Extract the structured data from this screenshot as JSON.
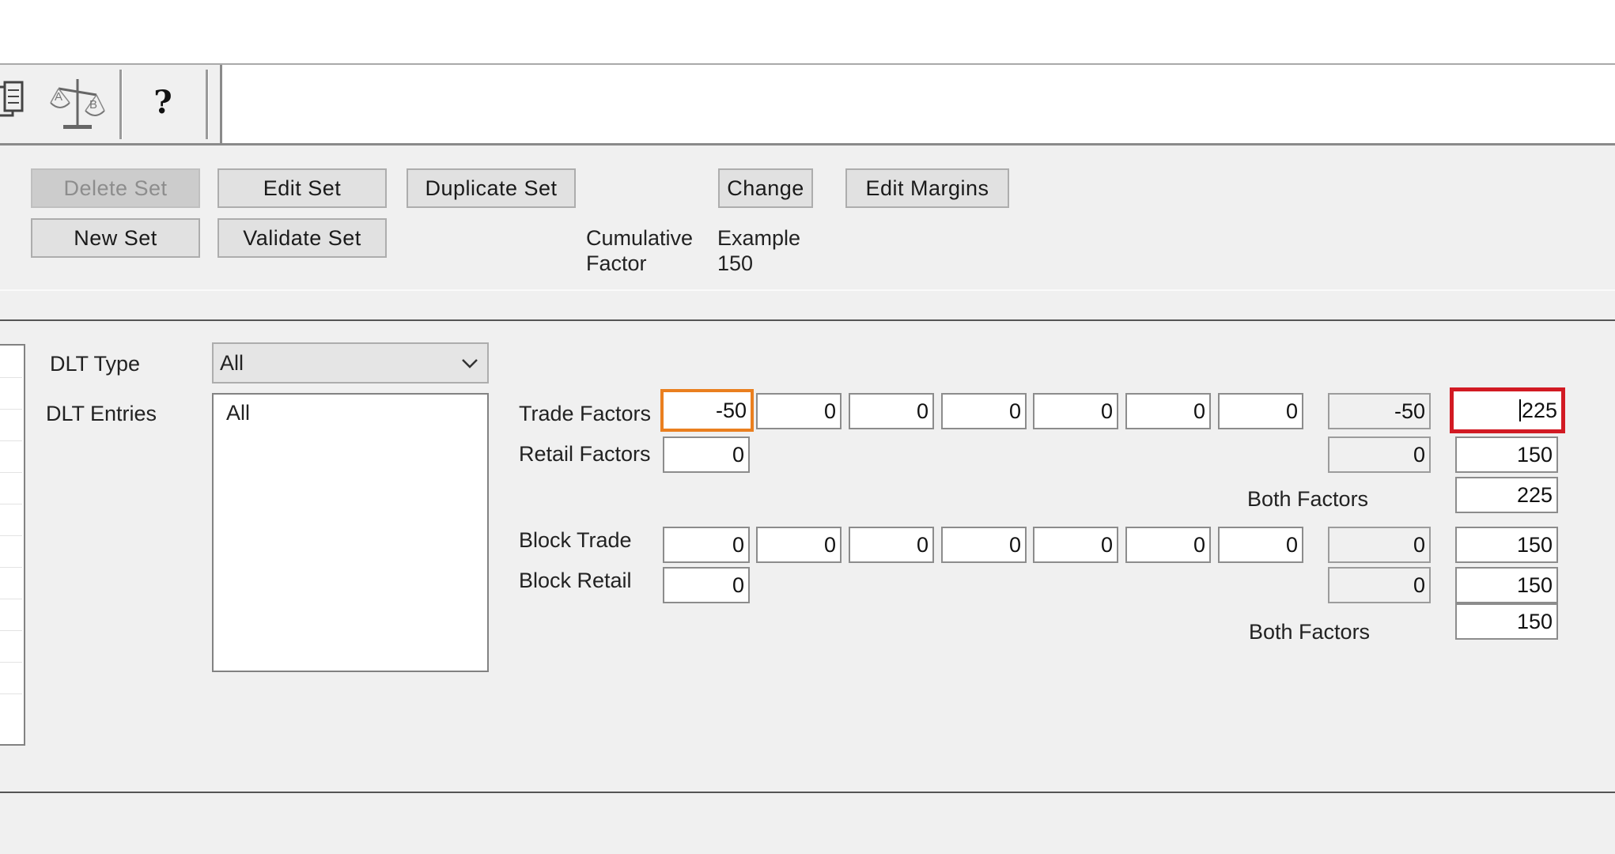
{
  "toolbar": {
    "icons": [
      "sets-icon",
      "ab-balance-icon",
      "help-icon"
    ],
    "help_glyph": "?"
  },
  "buttons": {
    "delete_set": "Delete Set",
    "edit_set": "Edit Set",
    "duplicate_set": "Duplicate Set",
    "change": "Change",
    "edit_margins": "Edit Margins",
    "new_set": "New Set",
    "validate_set": "Validate Set"
  },
  "cumulative": {
    "label_line1": "Cumulative",
    "label_line2": "Factor",
    "value_line1": "Example",
    "value_line2": "150"
  },
  "dlt": {
    "type_label": "DLT Type",
    "type_value": "All",
    "entries_label": "DLT Entries",
    "entries": [
      "All"
    ]
  },
  "factors": {
    "trade_label": "Trade Factors",
    "retail_label": "Retail Factors",
    "both_label": "Both Factors",
    "block_trade_label": "Block Trade",
    "block_retail_label": "Block Retail",
    "block_both_label": "Both Factors",
    "trade": [
      "-50",
      "0",
      "0",
      "0",
      "0",
      "0",
      "0"
    ],
    "trade_sum": "-50",
    "trade_total": "225",
    "retail": [
      "0"
    ],
    "retail_sum": "0",
    "retail_total": "150",
    "both_total": "225",
    "block_trade": [
      "0",
      "0",
      "0",
      "0",
      "0",
      "0",
      "0"
    ],
    "block_trade_sum": "0",
    "block_trade_total": "150",
    "block_retail": [
      "0"
    ],
    "block_retail_sum": "0",
    "block_retail_total": "150",
    "block_both_total": "150"
  },
  "colors": {
    "highlight_orange": "#ea7f1f",
    "highlight_red": "#d21a23"
  }
}
